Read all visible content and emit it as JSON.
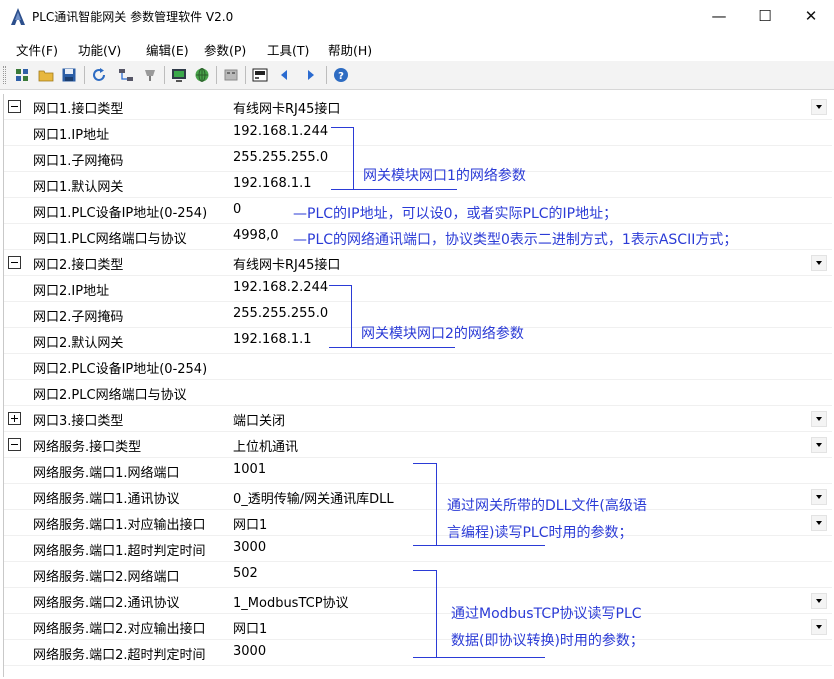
{
  "window": {
    "title": "PLC通讯智能网关 参数管理软件 V2.0",
    "minimize": "—",
    "maximize": "☐",
    "close": "✕"
  },
  "menu": [
    "文件(F)",
    "功能(V)",
    "编辑(E)",
    "参数(P)",
    "工具(T)",
    "帮助(H)"
  ],
  "toolbar": {
    "icons": [
      "download-params-icon",
      "open-folder-icon",
      "save-disk-icon",
      "refresh-icon",
      "network-icon",
      "device-icon",
      "monitor-icon",
      "globe-icon",
      "gateway-icon",
      "readout-icon",
      "arrow-left-icon",
      "arrow-right-icon",
      "help-icon"
    ]
  },
  "rows": [
    {
      "label": "网口1.接口类型",
      "value": "有线网卡RJ45接口",
      "expander": "minus",
      "dropdown": true
    },
    {
      "label": "网口1.IP地址",
      "value": "192.168.1.244"
    },
    {
      "label": "网口1.子网掩码",
      "value": "255.255.255.0"
    },
    {
      "label": "网口1.默认网关",
      "value": "192.168.1.1"
    },
    {
      "label": "网口1.PLC设备IP地址(0-254)",
      "value": "0"
    },
    {
      "label": "网口1.PLC网络端口与协议",
      "value": "4998,0"
    },
    {
      "label": "网口2.接口类型",
      "value": "有线网卡RJ45接口",
      "expander": "minus",
      "dropdown": true
    },
    {
      "label": "网口2.IP地址",
      "value": "192.168.2.244"
    },
    {
      "label": "网口2.子网掩码",
      "value": "255.255.255.0"
    },
    {
      "label": "网口2.默认网关",
      "value": "192.168.1.1"
    },
    {
      "label": "网口2.PLC设备IP地址(0-254)",
      "value": ""
    },
    {
      "label": "网口2.PLC网络端口与协议",
      "value": ""
    },
    {
      "label": "网口3.接口类型",
      "value": "端口关闭",
      "expander": "plus",
      "dropdown": true
    },
    {
      "label": "网络服务.接口类型",
      "value": "上位机通讯",
      "expander": "minus",
      "dropdown": true
    },
    {
      "label": "网络服务.端口1.网络端口",
      "value": "1001"
    },
    {
      "label": "网络服务.端口1.通讯协议",
      "value": "0_透明传输/网关通讯库DLL",
      "dropdown": true
    },
    {
      "label": "网络服务.端口1.对应输出接口",
      "value": "网口1",
      "dropdown": true
    },
    {
      "label": "网络服务.端口1.超时判定时间",
      "value": "3000"
    },
    {
      "label": "网络服务.端口2.网络端口",
      "value": "502"
    },
    {
      "label": "网络服务.端口2.通讯协议",
      "value": "1_ModbusTCP协议",
      "dropdown": true
    },
    {
      "label": "网络服务.端口2.对应输出接口",
      "value": "网口1",
      "dropdown": true
    },
    {
      "label": "网络服务.端口2.超时判定时间",
      "value": "3000"
    }
  ],
  "annotations": {
    "port1_params": "网关模块网口1的网络参数",
    "plc_ip_note": "—PLC的IP地址，可以设0，或者实际PLC的IP地址；",
    "plc_port_note": "—PLC的网络通讯端口，协议类型0表示二进制方式，1表示ASCII方式；",
    "port2_params": "网关模块网口2的网络参数",
    "dll_note_line1": "通过网关所带的DLL文件(高级语",
    "dll_note_line2": "言编程)读写PLC时用的参数；",
    "modbus_note_line1": "通过ModbusTCP协议读写PLC",
    "modbus_note_line2": "数据(即协议转换)时用的参数；"
  },
  "colors": {
    "annotation": "#2b3bd6",
    "toolbar_bg": "#f3f3f3"
  }
}
